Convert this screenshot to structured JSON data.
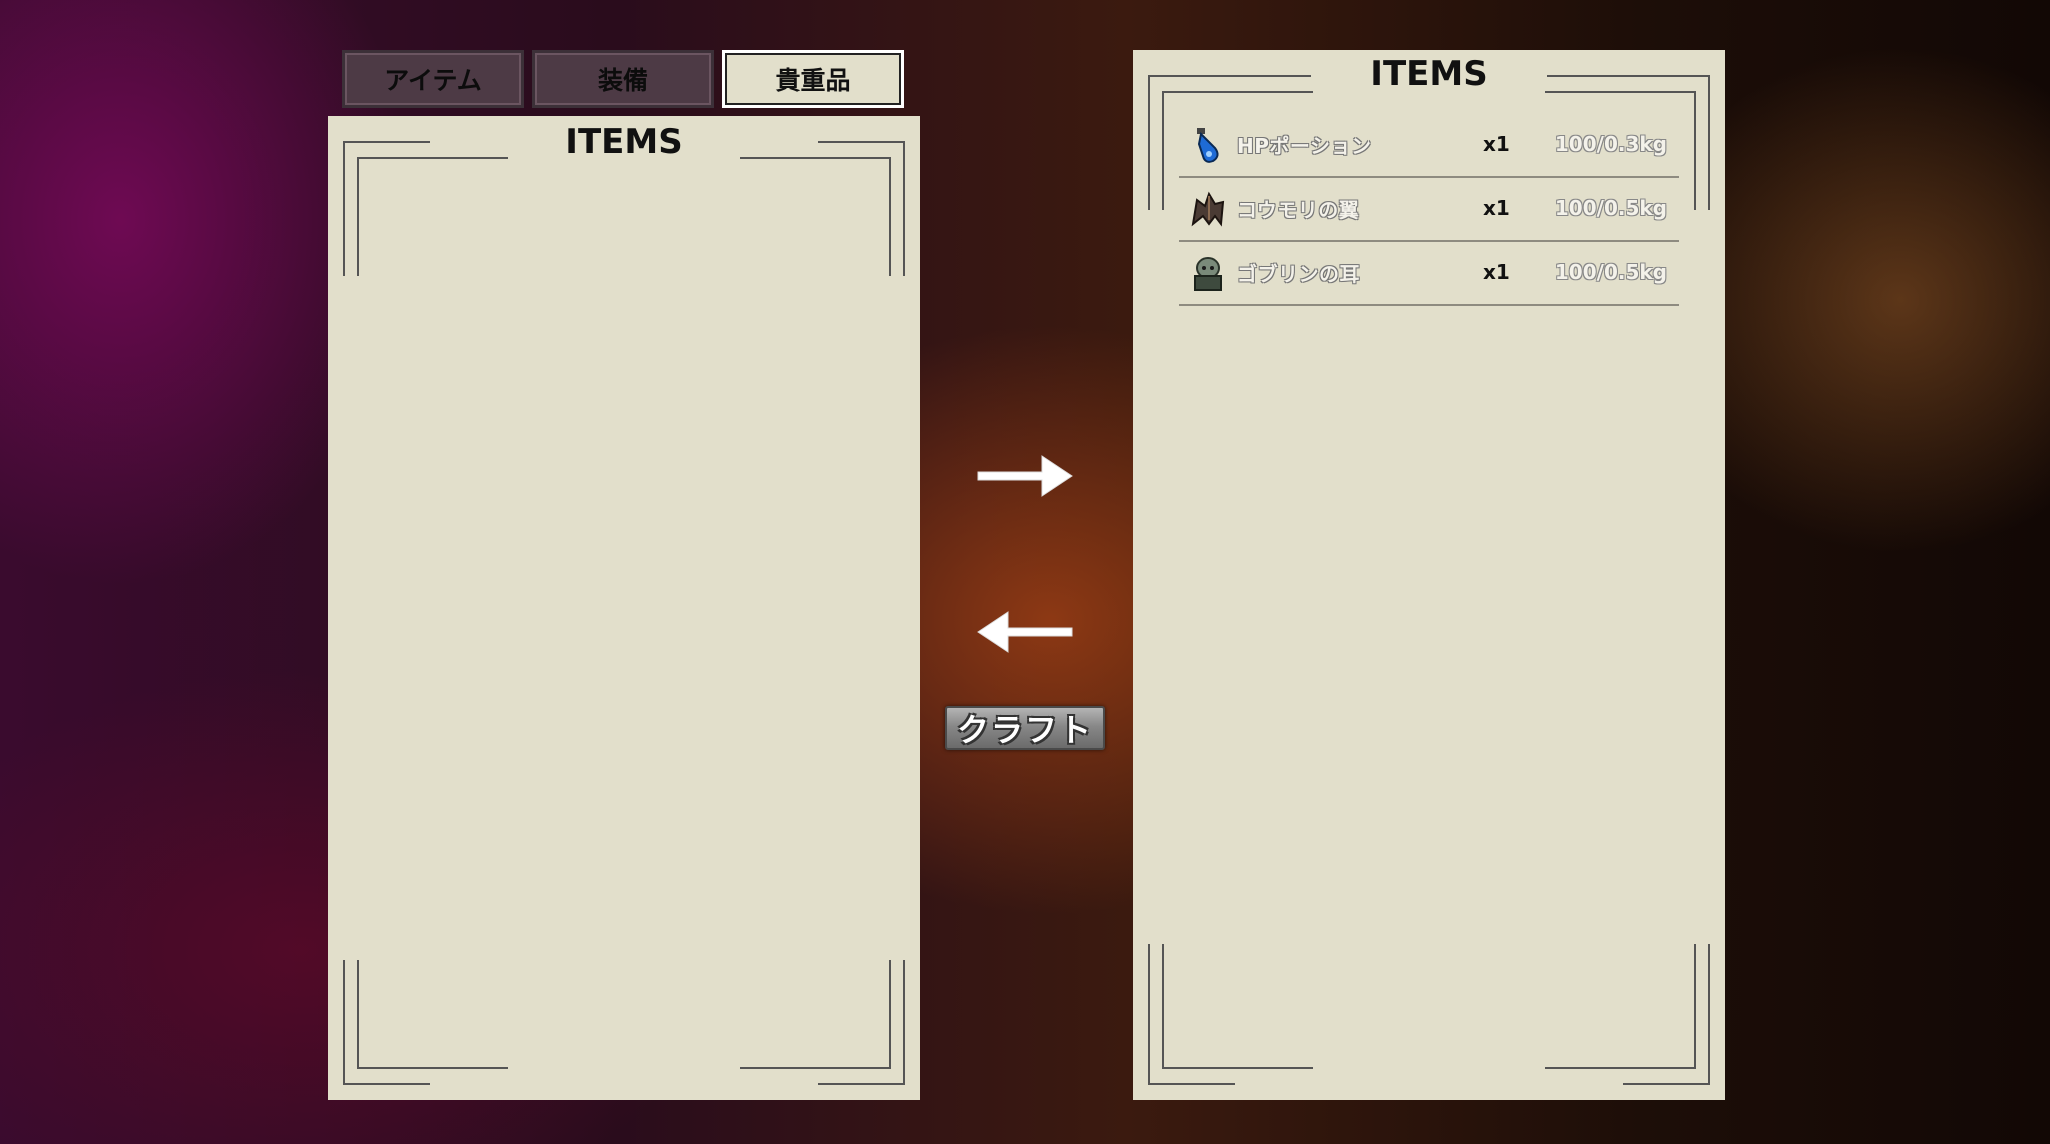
{
  "tabs": [
    {
      "label": "アイテム",
      "active": false
    },
    {
      "label": "装備",
      "active": false
    },
    {
      "label": "貴重品",
      "active": true
    }
  ],
  "left_panel": {
    "title": "ITEMS",
    "items": []
  },
  "right_panel": {
    "title": "ITEMS",
    "items": [
      {
        "name": "HPポーション",
        "qty": "x1",
        "weight": "100/0.3kg",
        "icon": "potion-icon"
      },
      {
        "name": "コウモリの翼",
        "qty": "x1",
        "weight": "100/0.5kg",
        "icon": "bat-wing-icon"
      },
      {
        "name": "ゴブリンの耳",
        "qty": "x1",
        "weight": "100/0.5kg",
        "icon": "goblin-ear-icon"
      }
    ]
  },
  "controls": {
    "move_right_icon": "arrow-right-icon",
    "move_left_icon": "arrow-left-icon",
    "craft_label": "クラフト"
  },
  "colors": {
    "panel": "#e2dfcb",
    "tab_inactive": "#4d3a45"
  }
}
